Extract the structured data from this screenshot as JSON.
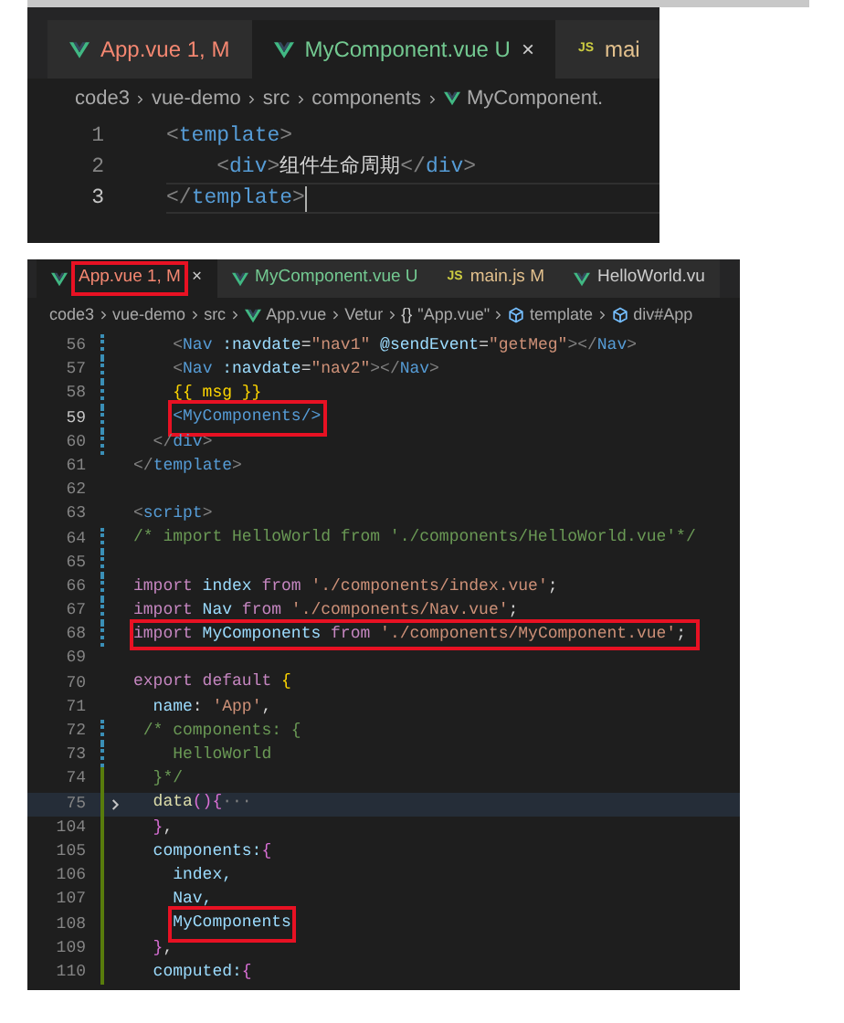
{
  "panels": [
    {
      "tabs": [
        {
          "kind": "vue-file",
          "label": "App.vue 1, M",
          "color": "#f48771",
          "selected": false,
          "boxed": false
        },
        {
          "kind": "vue-file",
          "label": "MyComponent.vue U",
          "color": "#73c991",
          "selected": true,
          "boxed": false,
          "close": "×"
        },
        {
          "kind": "js-file",
          "badge": "JS",
          "label": "mai",
          "color": "#e2c08d",
          "selected": false,
          "boxed": false
        }
      ],
      "breadcrumbs": [
        {
          "kind": "folder",
          "text": "code3"
        },
        {
          "kind": "folder",
          "text": "vue-demo"
        },
        {
          "kind": "folder",
          "text": "src"
        },
        {
          "kind": "folder",
          "text": "components"
        },
        {
          "kind": "vue-file",
          "text": "MyComponent."
        }
      ],
      "lines": [
        {
          "number": "1",
          "kind": "plain",
          "active": false,
          "cursor": false,
          "fold": false,
          "boxed": false,
          "tokens": [
            {
              "text": "<",
              "kind": "punct"
            },
            {
              "text": "template",
              "kind": "tag"
            },
            {
              "text": ">",
              "kind": "punct"
            }
          ]
        },
        {
          "number": "2",
          "kind": "plain",
          "active": false,
          "cursor": false,
          "fold": false,
          "boxed": false,
          "tokens": [
            {
              "text": "    <",
              "kind": "punct"
            },
            {
              "text": "div",
              "kind": "tag"
            },
            {
              "text": ">",
              "kind": "punct"
            },
            {
              "text": "组件生命周期",
              "kind": "text"
            },
            {
              "text": "</",
              "kind": "punct"
            },
            {
              "text": "div",
              "kind": "tag"
            },
            {
              "text": ">",
              "kind": "punct"
            }
          ]
        },
        {
          "number": "3",
          "kind": "plain",
          "active": true,
          "cursor": true,
          "fold": false,
          "boxed": false,
          "tokens": [
            {
              "text": "</",
              "kind": "punct"
            },
            {
              "text": "template",
              "kind": "tag"
            },
            {
              "text": ">",
              "kind": "punct"
            }
          ]
        }
      ]
    },
    {
      "tabs": [
        {
          "kind": "vue-file",
          "label": "App.vue 1, M",
          "color": "#f48771",
          "selected": true,
          "boxed": true,
          "close": "×"
        },
        {
          "kind": "vue-file",
          "label": "MyComponent.vue U",
          "color": "#73c991",
          "selected": false,
          "boxed": false
        },
        {
          "kind": "js-file",
          "badge": "JS",
          "label": "main.js M",
          "color": "#e2c08d",
          "selected": false,
          "boxed": false
        },
        {
          "kind": "vue-file",
          "label": "HelloWorld.vu",
          "color": "#cccccc",
          "selected": false,
          "boxed": false
        }
      ],
      "breadcrumbs": [
        {
          "kind": "folder",
          "text": "code3"
        },
        {
          "kind": "folder",
          "text": "vue-demo"
        },
        {
          "kind": "folder",
          "text": "src"
        },
        {
          "kind": "vue-file",
          "text": "App.vue"
        },
        {
          "kind": "folder",
          "text": "Vetur"
        },
        {
          "kind": "symbol",
          "symbol": "{}",
          "text": "\"App.vue\""
        },
        {
          "kind": "element",
          "text": "template"
        },
        {
          "kind": "element",
          "text": "div#App"
        }
      ],
      "lines": [
        {
          "number": "56",
          "kind": "modified",
          "active": false,
          "cursor": false,
          "fold": false,
          "boxed": false,
          "tokens": [
            {
              "text": "    <",
              "kind": "punct"
            },
            {
              "text": "Nav",
              "kind": "tag"
            },
            {
              "text": " :navdate",
              "kind": "attr"
            },
            {
              "text": "=",
              "kind": "plain"
            },
            {
              "text": "\"nav1\"",
              "kind": "string"
            },
            {
              "text": " @sendEvent",
              "kind": "attr"
            },
            {
              "text": "=",
              "kind": "plain"
            },
            {
              "text": "\"getMeg\"",
              "kind": "string"
            },
            {
              "text": "></",
              "kind": "punct"
            },
            {
              "text": "Nav",
              "kind": "tag"
            },
            {
              "text": ">",
              "kind": "punct"
            }
          ]
        },
        {
          "number": "57",
          "kind": "modified",
          "active": false,
          "cursor": false,
          "fold": false,
          "boxed": false,
          "tokens": [
            {
              "text": "    <",
              "kind": "punct"
            },
            {
              "text": "Nav",
              "kind": "tag"
            },
            {
              "text": " :navdate",
              "kind": "attr"
            },
            {
              "text": "=",
              "kind": "plain"
            },
            {
              "text": "\"nav2\"",
              "kind": "string"
            },
            {
              "text": "></",
              "kind": "punct"
            },
            {
              "text": "Nav",
              "kind": "tag"
            },
            {
              "text": ">",
              "kind": "punct"
            }
          ]
        },
        {
          "number": "58",
          "kind": "modified",
          "active": false,
          "cursor": false,
          "fold": false,
          "boxed": false,
          "tokens": [
            {
              "text": "    {{ msg }}",
              "kind": "brace"
            }
          ]
        },
        {
          "number": "59",
          "kind": "modified",
          "active": true,
          "cursor": false,
          "fold": false,
          "boxed": false,
          "tokens": [
            {
              "text": "    <MyComponents/>",
              "kind": "tag",
              "boxed": true
            }
          ]
        },
        {
          "number": "60",
          "kind": "modified",
          "active": false,
          "cursor": false,
          "fold": false,
          "boxed": false,
          "tokens": [
            {
              "text": "  </",
              "kind": "punct"
            },
            {
              "text": "div",
              "kind": "tag"
            },
            {
              "text": ">",
              "kind": "punct"
            }
          ]
        },
        {
          "number": "61",
          "kind": "plain",
          "active": false,
          "cursor": false,
          "fold": false,
          "boxed": false,
          "tokens": [
            {
              "text": "</",
              "kind": "punct"
            },
            {
              "text": "template",
              "kind": "tag"
            },
            {
              "text": ">",
              "kind": "punct"
            }
          ]
        },
        {
          "number": "62",
          "kind": "plain",
          "active": false,
          "cursor": false,
          "fold": false,
          "boxed": false
        },
        {
          "number": "63",
          "kind": "plain",
          "active": false,
          "cursor": false,
          "fold": false,
          "boxed": false,
          "tokens": [
            {
              "text": "<",
              "kind": "punct"
            },
            {
              "text": "script",
              "kind": "tag"
            },
            {
              "text": ">",
              "kind": "punct"
            }
          ]
        },
        {
          "number": "64",
          "kind": "modified",
          "active": false,
          "cursor": false,
          "fold": false,
          "boxed": false,
          "tokens": [
            {
              "text": "/* import HelloWorld from './components/HelloWorld.vue'*/",
              "kind": "comment"
            }
          ]
        },
        {
          "number": "65",
          "kind": "modified",
          "active": false,
          "cursor": false,
          "fold": false,
          "boxed": false
        },
        {
          "number": "66",
          "kind": "modified",
          "active": false,
          "cursor": false,
          "fold": false,
          "boxed": false,
          "tokens": [
            {
              "text": "import",
              "kind": "keyword"
            },
            {
              "text": " index ",
              "kind": "ident"
            },
            {
              "text": "from",
              "kind": "keyword"
            },
            {
              "text": " './components/index.vue'",
              "kind": "string"
            },
            {
              "text": ";",
              "kind": "plain"
            }
          ]
        },
        {
          "number": "67",
          "kind": "modified",
          "active": false,
          "cursor": false,
          "fold": false,
          "boxed": false,
          "tokens": [
            {
              "text": "import",
              "kind": "keyword"
            },
            {
              "text": " Nav ",
              "kind": "ident"
            },
            {
              "text": "from",
              "kind": "keyword"
            },
            {
              "text": " './components/Nav.vue'",
              "kind": "string"
            },
            {
              "text": ";",
              "kind": "plain"
            }
          ]
        },
        {
          "number": "68",
          "kind": "modified",
          "active": false,
          "cursor": false,
          "fold": false,
          "boxed": true,
          "tokens": [
            {
              "text": "import",
              "kind": "keyword"
            },
            {
              "text": " MyComponents ",
              "kind": "ident"
            },
            {
              "text": "from",
              "kind": "keyword"
            },
            {
              "text": " './components/MyComponent.vue'",
              "kind": "string"
            },
            {
              "text": ";",
              "kind": "plain"
            }
          ]
        },
        {
          "number": "69",
          "kind": "plain",
          "active": false,
          "cursor": false,
          "fold": false,
          "boxed": false
        },
        {
          "number": "70",
          "kind": "plain",
          "active": false,
          "cursor": false,
          "fold": false,
          "boxed": false,
          "tokens": [
            {
              "text": "export default ",
              "kind": "keyword"
            },
            {
              "text": "{",
              "kind": "brace"
            }
          ]
        },
        {
          "number": "71",
          "kind": "plain",
          "active": false,
          "cursor": false,
          "fold": false,
          "boxed": false,
          "tokens": [
            {
              "text": "  name",
              "kind": "ident"
            },
            {
              "text": ": ",
              "kind": "plain"
            },
            {
              "text": "'App'",
              "kind": "string"
            },
            {
              "text": ",",
              "kind": "plain"
            }
          ]
        },
        {
          "number": "72",
          "kind": "modified",
          "active": false,
          "cursor": false,
          "fold": false,
          "boxed": false,
          "tokens": [
            {
              "text": " /* components: {",
              "kind": "comment"
            }
          ]
        },
        {
          "number": "73",
          "kind": "modified",
          "active": false,
          "cursor": false,
          "fold": false,
          "boxed": false,
          "tokens": [
            {
              "text": "    HelloWorld",
              "kind": "comment"
            }
          ]
        },
        {
          "number": "74",
          "kind": "added",
          "active": false,
          "cursor": false,
          "fold": false,
          "boxed": false,
          "tokens": [
            {
              "text": "  }*/",
              "kind": "comment"
            }
          ]
        },
        {
          "number": "75",
          "kind": "added",
          "active": false,
          "cursor": false,
          "fold": true,
          "boxed": false,
          "tokens": [
            {
              "text": "  data",
              "kind": "func"
            },
            {
              "text": "()",
              "kind": "paren"
            },
            {
              "text": "{",
              "kind": "paren"
            },
            {
              "text": "···",
              "kind": "punct"
            }
          ]
        },
        {
          "number": "104",
          "kind": "added",
          "active": false,
          "cursor": false,
          "fold": false,
          "boxed": false,
          "tokens": [
            {
              "text": "  }",
              "kind": "paren"
            },
            {
              "text": ",",
              "kind": "plain"
            }
          ]
        },
        {
          "number": "105",
          "kind": "added",
          "active": false,
          "cursor": false,
          "fold": false,
          "boxed": false,
          "tokens": [
            {
              "text": "  components:",
              "kind": "ident"
            },
            {
              "text": "{",
              "kind": "paren"
            }
          ]
        },
        {
          "number": "106",
          "kind": "added",
          "active": false,
          "cursor": false,
          "fold": false,
          "boxed": false,
          "tokens": [
            {
              "text": "    index,",
              "kind": "ident"
            }
          ]
        },
        {
          "number": "107",
          "kind": "added",
          "active": false,
          "cursor": false,
          "fold": false,
          "boxed": false,
          "tokens": [
            {
              "text": "    Nav,",
              "kind": "ident"
            }
          ]
        },
        {
          "number": "108",
          "kind": "added",
          "active": false,
          "cursor": false,
          "fold": false,
          "boxed": false,
          "tokens": [
            {
              "text": "    MyComponents",
              "kind": "ident",
              "boxed": true
            }
          ]
        },
        {
          "number": "109",
          "kind": "added",
          "active": false,
          "cursor": false,
          "fold": false,
          "boxed": false,
          "tokens": [
            {
              "text": "  }",
              "kind": "paren"
            },
            {
              "text": ",",
              "kind": "plain"
            }
          ]
        },
        {
          "number": "110",
          "kind": "added",
          "active": false,
          "cursor": false,
          "fold": false,
          "boxed": false,
          "tokens": [
            {
              "text": "  computed:",
              "kind": "ident"
            },
            {
              "text": "{",
              "kind": "paren"
            }
          ]
        }
      ]
    }
  ]
}
